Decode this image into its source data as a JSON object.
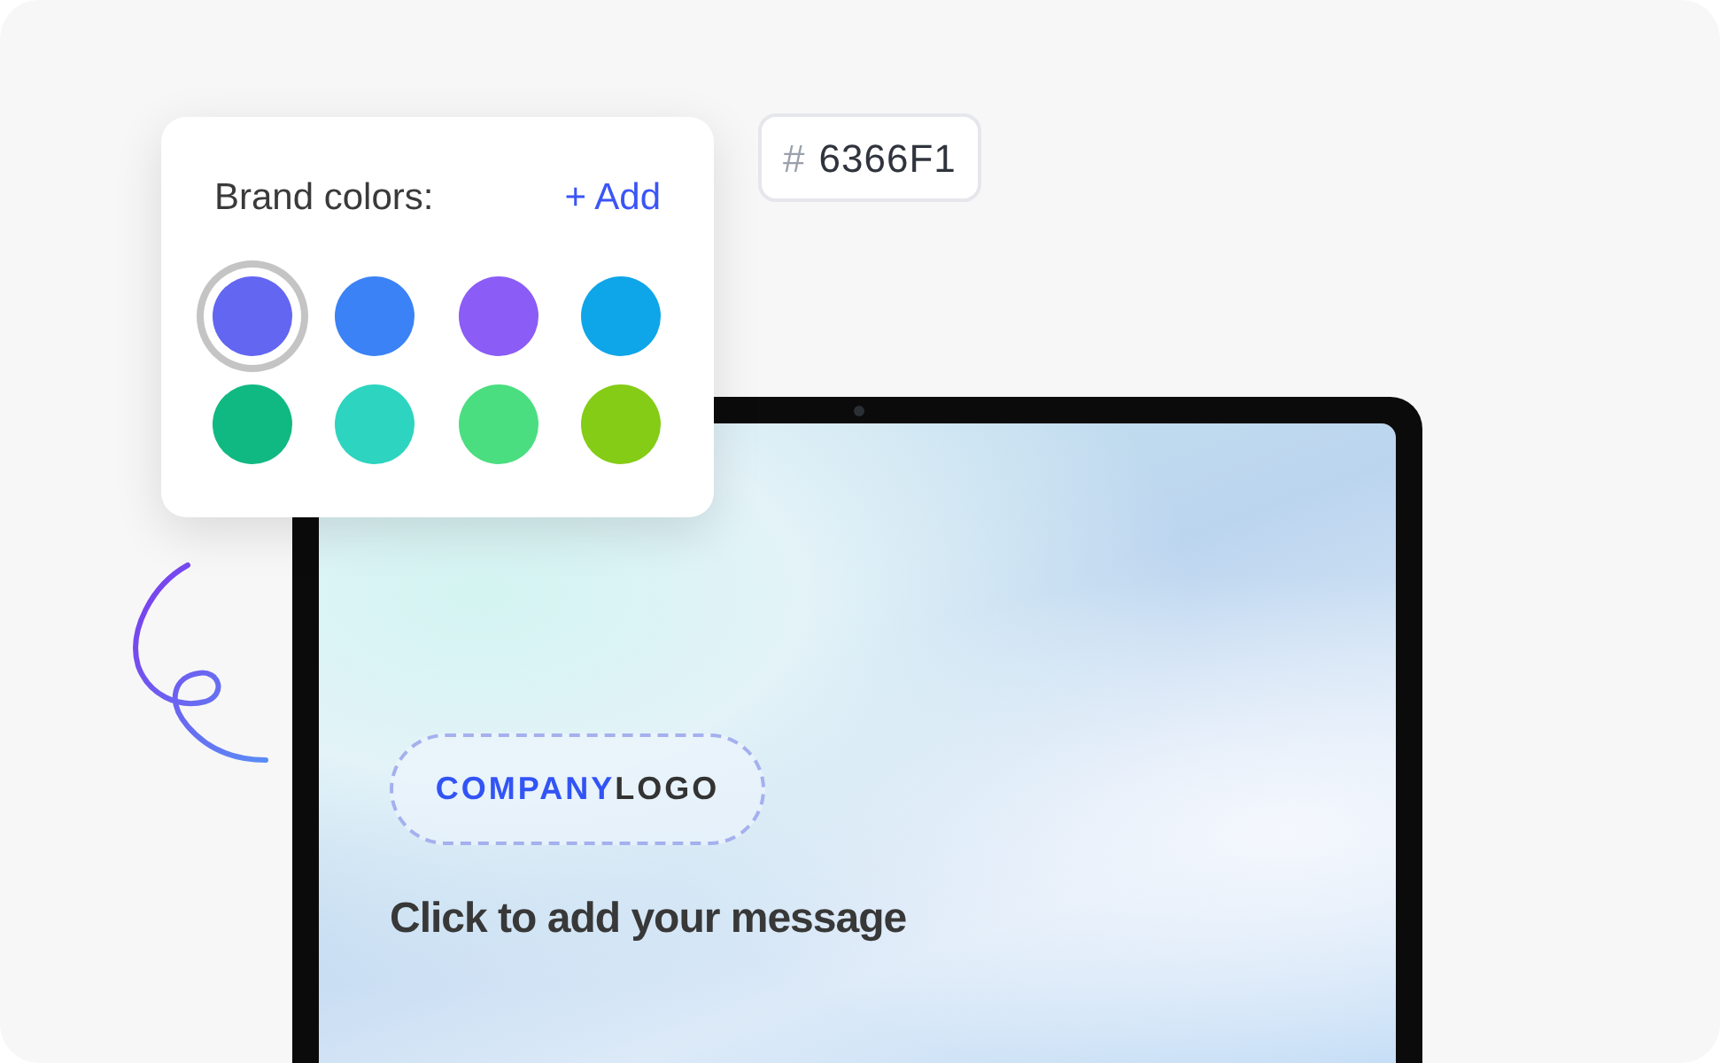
{
  "palette": {
    "title": "Brand colors:",
    "add_link": "+ Add",
    "swatches": [
      {
        "color": "#6366f1",
        "selected": true
      },
      {
        "color": "#3b82f6",
        "selected": false
      },
      {
        "color": "#8b5cf6",
        "selected": false
      },
      {
        "color": "#0ea5e9",
        "selected": false
      },
      {
        "color": "#10b981",
        "selected": false
      },
      {
        "color": "#2dd4bf",
        "selected": false
      },
      {
        "color": "#4ade80",
        "selected": false
      },
      {
        "color": "#84cc16",
        "selected": false
      }
    ]
  },
  "hex_chip": {
    "hash": "#",
    "value": "6366F1"
  },
  "screen": {
    "logo": {
      "primary": "COMPANY",
      "secondary": "LOGO"
    },
    "message": "Click to add your message"
  }
}
